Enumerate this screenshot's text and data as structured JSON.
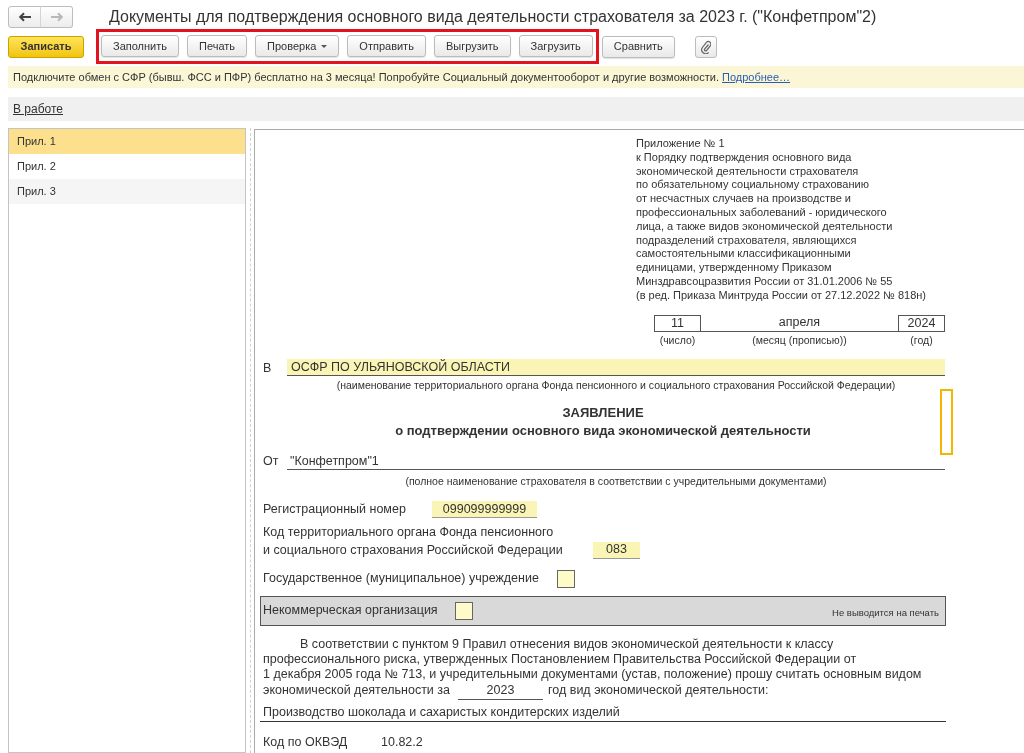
{
  "nav_buttons": [
    {
      "kind": "back",
      "disabled": false
    },
    {
      "kind": "forward",
      "disabled": true
    }
  ],
  "window": {
    "title": "Документы для подтверждения основного вида деятельности страхователя за 2023 г. (\"Конфетпром\"2)"
  },
  "toolbar": {
    "save_button": "Записать",
    "groups": [
      {
        "highlighted": true,
        "buttons": [
          {
            "label": "Заполнить",
            "dropdown": false
          },
          {
            "label": "Печать",
            "dropdown": false
          },
          {
            "label": "Проверка",
            "dropdown": true
          },
          {
            "label": "Отправить",
            "dropdown": false
          },
          {
            "label": "Выгрузить",
            "dropdown": false
          },
          {
            "label": "Загрузить",
            "dropdown": false
          }
        ]
      },
      {
        "highlighted": false,
        "buttons": [
          {
            "label": "Сравнить",
            "dropdown": false
          }
        ]
      }
    ]
  },
  "banner": {
    "text": "Подключите обмен с СФР (бывш. ФСС и ПФР) бесплатно на 3 месяца! Попробуйте Социальный документооборот и другие возможности.",
    "link": "Подробнее…"
  },
  "status_link": "В работе",
  "sidebar": {
    "items": [
      {
        "label": "Прил. 1",
        "selected": true
      },
      {
        "label": "Прил. 2",
        "selected": false
      },
      {
        "label": "Прил. 3",
        "selected": false
      }
    ]
  },
  "document": {
    "appendix_lines": [
      "Приложение № 1",
      "к Порядку подтверждения основного вида",
      "экономической деятельности страхователя",
      "по обязательному социальному страхованию",
      "от несчастных случаев на производстве и",
      "профессиональных заболеваний - юридического",
      "лица, а также видов экономической деятельности",
      "подразделений страхователя, являющихся",
      "самостоятельными классификационными",
      "единицами, утвержденному Приказом",
      "Минздравсоцразвития России от 31.01.2006 № 55",
      "(в ред. Приказа Минтруда России от 27.12.2022 № 818н)"
    ],
    "date": {
      "day": "11",
      "month": "апреля",
      "year": "2024",
      "day_caption": "(число)",
      "month_caption": "(месяц (прописью))",
      "year_caption": "(год)"
    },
    "recipient": {
      "label": "В",
      "value": "ОСФР ПО УЛЬЯНОВСКОЙ ОБЛАСТИ",
      "caption": "(наименование территориального органа Фонда пенсионного и социального страхования Российской Федерации)"
    },
    "heading": {
      "title": "ЗАЯВЛЕНИЕ",
      "subtitle": "о подтверждении основного вида экономической деятельности"
    },
    "insurer": {
      "label": "От",
      "value": "\"Конфетпром\"1",
      "caption": "(полное наименование страхователя в соответствии с учредительными документами)"
    },
    "registration_number": {
      "label": "Регистрационный номер",
      "value": "099099999999"
    },
    "territorial_code": {
      "label_lines": [
        "Код территориального органа Фонда пенсионного",
        "и социального страхования Российской Федерации"
      ],
      "value": "083"
    },
    "state_institution": {
      "label": "Государственное (муниципальное) учреждение",
      "checked": false
    },
    "nonprofit": {
      "label": "Некоммерческая организация",
      "checked": false,
      "note": "Не выводится на печать"
    },
    "statement": {
      "lines": [
        "В соответствии с пунктом 9 Правил отнесения видов экономической деятельности к классу",
        "профессионального риска, утвержденных Постановлением Правительства Российской Федерации от",
        "1 декабря 2005 года № 713, и учредительными документами (устав, положение) прошу считать основным видом"
      ],
      "before_year": "экономической деятельности за",
      "year": "2023",
      "after_year": "год вид экономической деятельности:"
    },
    "activity": "Производство шоколада и сахаристых кондитерских изделий",
    "okved": {
      "label": "Код по ОКВЭД",
      "value": "10.82.2"
    }
  }
}
